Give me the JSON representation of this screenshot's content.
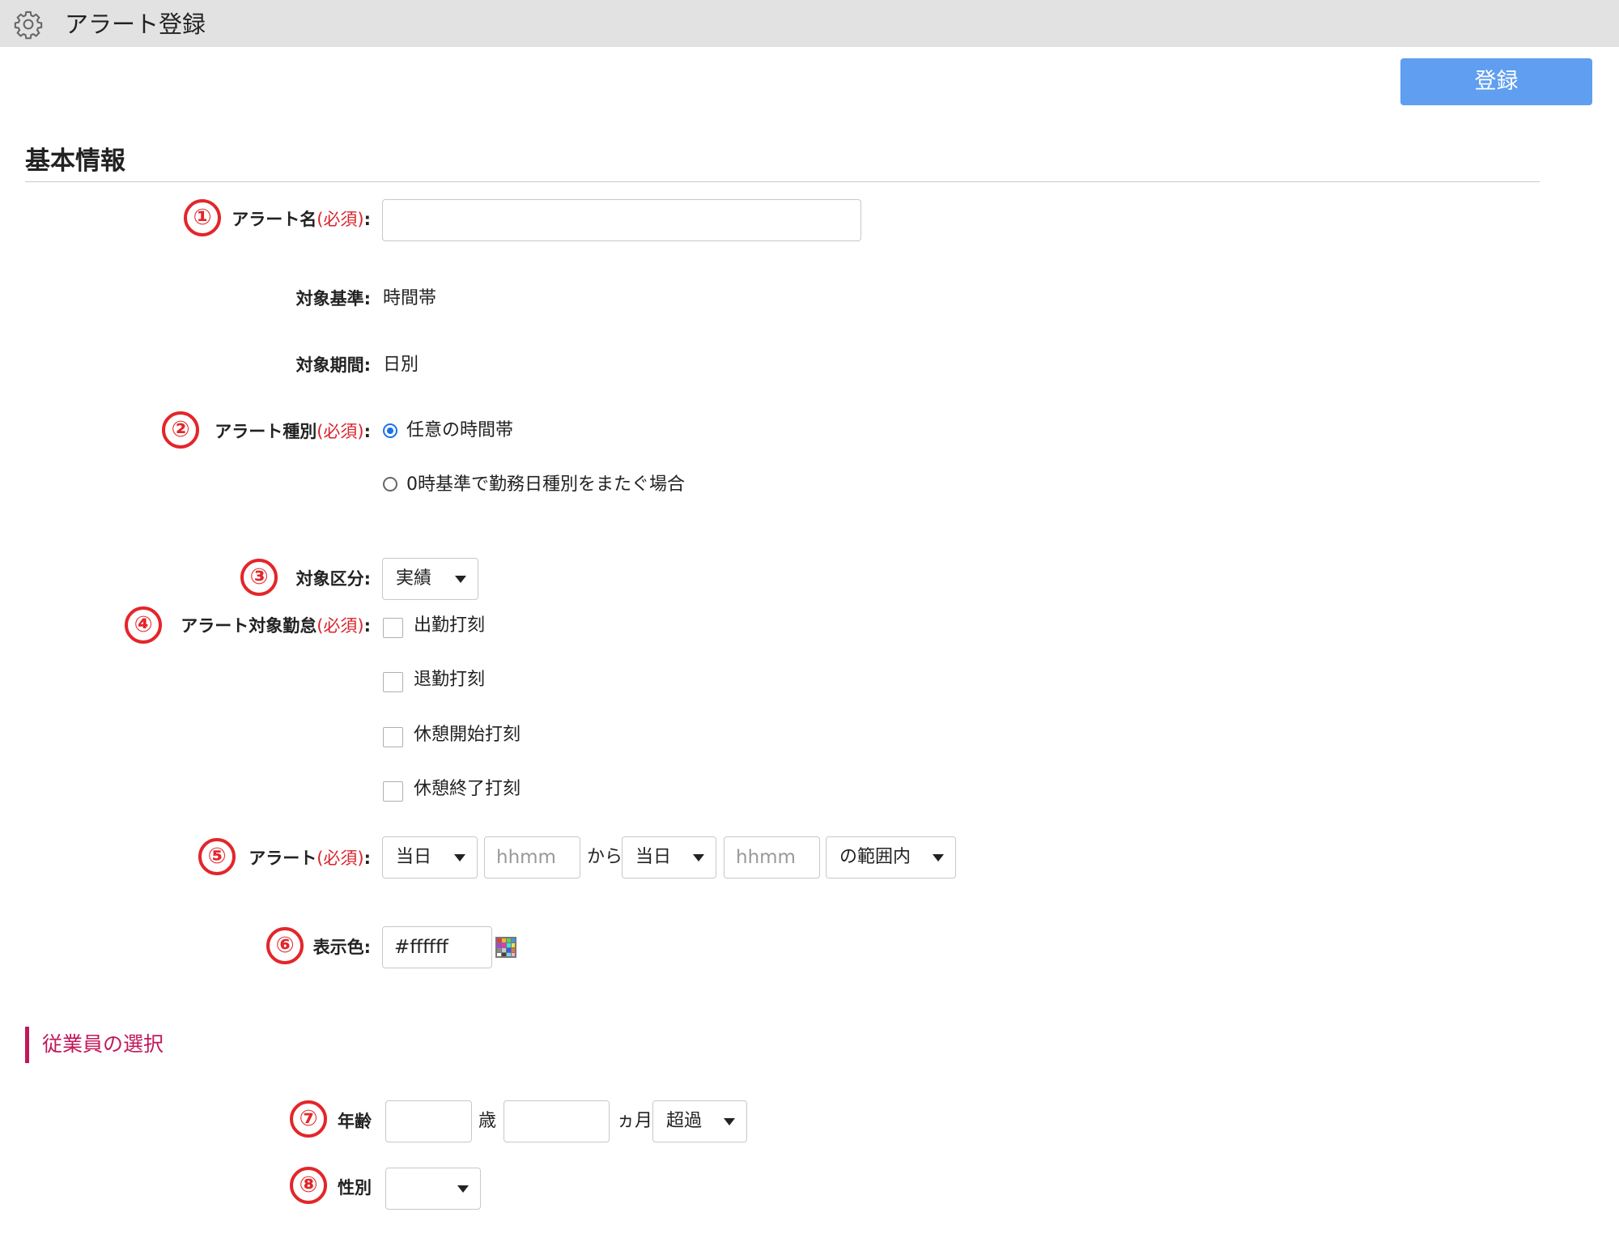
{
  "window": {
    "title": "アラート登録",
    "settings_icon": "gear-icon"
  },
  "toolbar": {
    "register_label": "登録",
    "register_color": "#5f9ef0"
  },
  "basic_section": {
    "heading": "基本情報",
    "alert_name": {
      "number": "①",
      "label": "アラート名",
      "required": "(必須)",
      "colon": ":",
      "value": ""
    },
    "target_basis": {
      "label": "対象基準",
      "colon": ":",
      "value": "時間帯"
    },
    "target_period": {
      "label": "対象期間",
      "colon": ":",
      "value": "日別"
    },
    "alert_type": {
      "number": "②",
      "label": "アラート種別",
      "required": "(必須)",
      "colon": ":",
      "options": [
        {
          "label": "任意の時間帯",
          "selected": true
        },
        {
          "label": "0時基準で勤務日種別をまたぐ場合",
          "selected": false
        }
      ]
    },
    "target_category": {
      "number": "③",
      "label": "対象区分",
      "colon": ":",
      "selected": "実績"
    },
    "target_attendance": {
      "number": "④",
      "label": "アラート対象勤怠",
      "required": "(必須)",
      "colon": ":",
      "options": [
        {
          "label": "出勤打刻",
          "checked": false
        },
        {
          "label": "退勤打刻",
          "checked": false
        },
        {
          "label": "休憩開始打刻",
          "checked": false
        },
        {
          "label": "休憩終了打刻",
          "checked": false
        }
      ]
    },
    "alert_range": {
      "number": "⑤",
      "label": "アラート",
      "required": "(必須)",
      "colon": ":",
      "from_day": "当日",
      "from_time_placeholder": "hhmm",
      "from_text": "から",
      "to_day": "当日",
      "to_time_placeholder": "hhmm",
      "range_mode": "の範囲内"
    },
    "display_color": {
      "number": "⑥",
      "label": "表示色",
      "colon": ":",
      "value": "#ffffff",
      "palette_icon": "color-palette-icon"
    }
  },
  "employee_section": {
    "heading": "従業員の選択",
    "accent_color": "#c2185b",
    "age": {
      "number": "⑦",
      "label": "年齢",
      "years_value": "",
      "years_unit": "歳",
      "months_value": "",
      "months_unit": "ヵ月",
      "comparison": "超過"
    },
    "gender": {
      "number": "⑧",
      "label": "性別",
      "selected": ""
    }
  }
}
